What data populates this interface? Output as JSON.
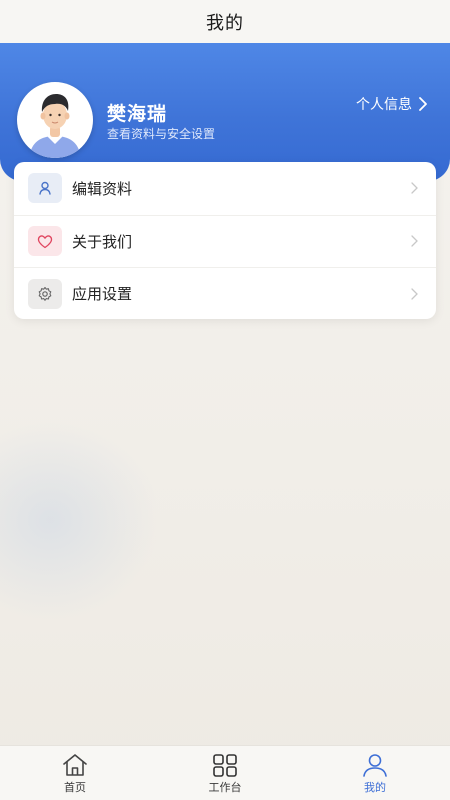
{
  "header": {
    "title": "我的"
  },
  "profile": {
    "name": "樊海瑞",
    "subtitle": "查看资料与安全设置",
    "link_label": "个人信息"
  },
  "menu": [
    {
      "label": "编辑资料",
      "icon": "user-icon"
    },
    {
      "label": "关于我们",
      "icon": "heart-icon"
    },
    {
      "label": "应用设置",
      "icon": "gear-icon"
    }
  ],
  "tabbar": {
    "items": [
      {
        "label": "首页",
        "icon": "home-icon",
        "active": false
      },
      {
        "label": "工作台",
        "icon": "grid-icon",
        "active": false
      },
      {
        "label": "我的",
        "icon": "person-icon",
        "active": true
      }
    ]
  },
  "colors": {
    "accent": "#3e6fd6",
    "hero_top": "#4f87e6",
    "hero_bottom": "#356ad2",
    "heart": "#e0455f"
  }
}
